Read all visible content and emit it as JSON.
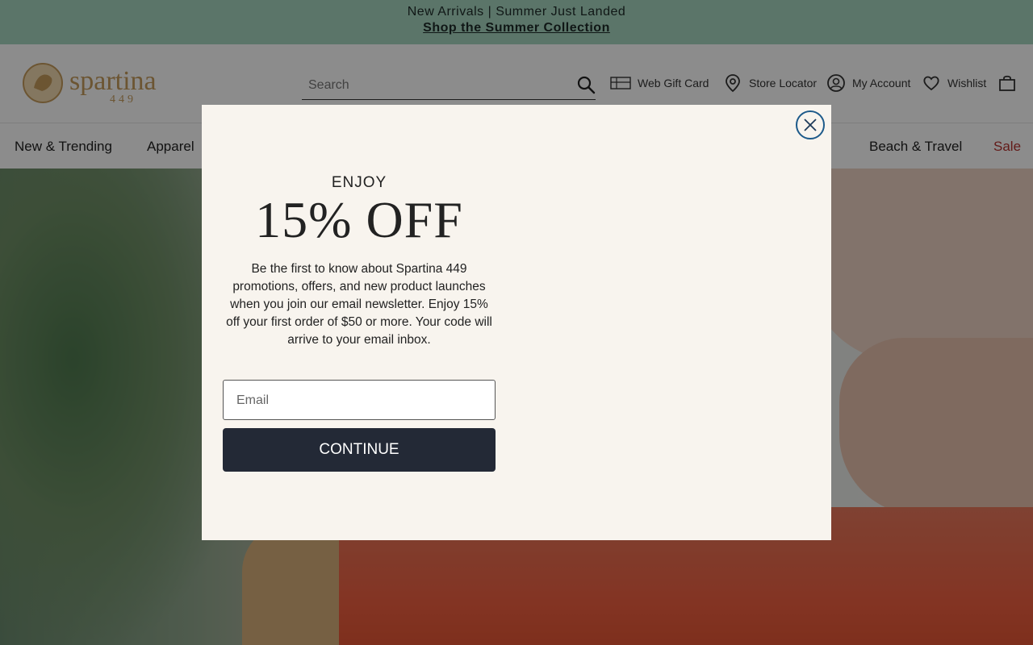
{
  "announcement": {
    "headline": "New Arrivals | Summer Just Landed",
    "link": "Shop the Summer Collection"
  },
  "header": {
    "logo_text": "spartina",
    "logo_subtext": "449",
    "search_placeholder": "Search",
    "gift_card": "Web Gift Card",
    "store_locator": "Store Locator",
    "account": "My Account",
    "wishlist": "Wishlist"
  },
  "nav": {
    "items": [
      {
        "label": "New & Trending"
      },
      {
        "label": "Apparel"
      },
      {
        "label": "Beach & Travel"
      },
      {
        "label": "Sale"
      }
    ]
  },
  "modal": {
    "enjoy": "ENJOY",
    "offer": "15% OFF",
    "body": "Be the first to know about Spartina 449 promotions, offers, and new product launches when you join our email newsletter. Enjoy 15% off your first order of $50 or more. Your code will arrive to your email inbox.",
    "email_placeholder": "Email",
    "continue_label": "CONTINUE"
  },
  "colors": {
    "announcement_bg": "#a6d6bf",
    "modal_bg": "#f8f4ee",
    "button_bg": "#232936",
    "sale": "#b5322e",
    "close_ring": "#1d5a8a"
  }
}
